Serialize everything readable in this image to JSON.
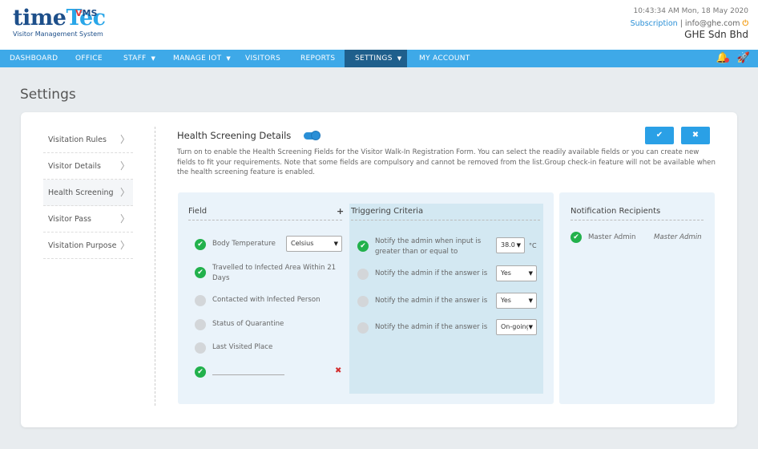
{
  "header": {
    "logo_text_a": "time",
    "logo_text_b": "Tec",
    "logo_vms_v": "V",
    "logo_vms_rest": "MS",
    "logo_sub": "Visitor Management System",
    "datetime": "10:43:34 AM  Mon, 18 May 2020",
    "subscription": "Subscription",
    "separator": "|",
    "email": "info@ghe.com",
    "power_icon": "power-icon",
    "company": "GHE Sdn Bhd"
  },
  "nav": {
    "items": [
      {
        "label": "DASHBOARD",
        "dropdown": false,
        "active": false
      },
      {
        "label": "OFFICE",
        "dropdown": false,
        "active": false
      },
      {
        "label": "STAFF",
        "dropdown": true,
        "active": false
      },
      {
        "label": "MANAGE IOT",
        "dropdown": true,
        "active": false
      },
      {
        "label": "VISITORS",
        "dropdown": false,
        "active": false
      },
      {
        "label": "REPORTS",
        "dropdown": false,
        "active": false
      },
      {
        "label": "SETTINGS",
        "dropdown": true,
        "active": true
      },
      {
        "label": "MY ACCOUNT",
        "dropdown": false,
        "active": false
      }
    ],
    "icons": [
      "bell-icon",
      "rocket-icon"
    ],
    "accent": "#3ea9e8",
    "active_color": "#1f5f8c"
  },
  "page_title": "Settings",
  "sidebar": {
    "items": [
      {
        "label": "Visitation Rules",
        "active": false
      },
      {
        "label": "Visitor Details",
        "active": false
      },
      {
        "label": "Health Screening",
        "active": true
      },
      {
        "label": "Visitor Pass",
        "active": false
      },
      {
        "label": "Visitation Purpose",
        "active": false
      }
    ]
  },
  "health": {
    "title": "Health Screening Details",
    "enabled": true,
    "description": "Turn on to enable the Health Screening Fields for the Visitor Walk-In Registration Form. You can select the readily available fields or you can create new fields to fit your requirements. Note that some fields are compulsory and cannot be removed from the list.Group check-in feature will not be available when the health screening feature is enabled.",
    "save_icon": "checkmark-icon",
    "cancel_icon": "close-icon",
    "field_header": "Field",
    "add_symbol": "+",
    "trigger_header": "Triggering Criteria",
    "fields": [
      {
        "label": "Body Temperature",
        "checked": true,
        "unit_select": "Celsius"
      },
      {
        "label": "Travelled to Infected Area Within 21 Days",
        "checked": true
      },
      {
        "label": "Contacted with Infected Person",
        "checked": false
      },
      {
        "label": "Status of Quarantine",
        "checked": false
      },
      {
        "label": "Last Visited Place",
        "checked": false
      },
      {
        "label": "",
        "checked": true,
        "custom": true,
        "delete_symbol": "✖"
      }
    ],
    "triggers": [
      {
        "label": "Notify the admin when input is greater than or equal to",
        "checked": true,
        "value": "38.0",
        "unit": "°C"
      },
      {
        "label": "Notify the admin if the answer is",
        "checked": false,
        "value": "Yes"
      },
      {
        "label": "Notify the admin if the answer is",
        "checked": false,
        "value": "Yes"
      },
      {
        "label": "Notify the admin if the answer is",
        "checked": false,
        "value": "On-going"
      }
    ]
  },
  "recipients": {
    "header": "Notification Recipients",
    "items": [
      {
        "name": "Master Admin",
        "role": "Master Admin",
        "checked": true
      }
    ]
  },
  "check_mark": "✔",
  "chevron": "〉",
  "select_arrow": "▼"
}
